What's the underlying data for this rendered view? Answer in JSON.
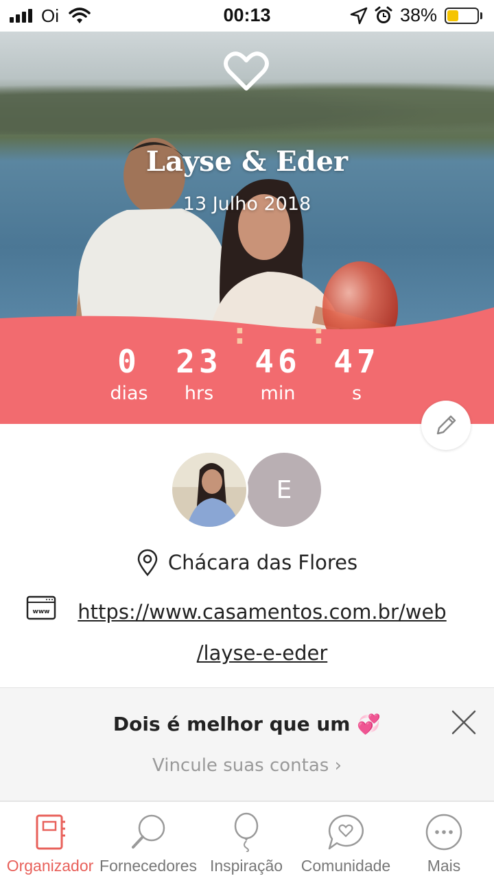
{
  "status_bar": {
    "carrier": "Oi",
    "time": "00:13",
    "battery_percent": "38%",
    "battery_level": 0.38
  },
  "hero": {
    "names": "Layse & Eder",
    "date": "13 Julho 2018",
    "countdown": {
      "days": "0",
      "days_label": "dias",
      "hours": "23",
      "hours_label": "hrs",
      "minutes": "46",
      "minutes_label": "min",
      "seconds": "47",
      "seconds_label": "s"
    }
  },
  "profile": {
    "partner_initial": "E",
    "venue": "Chácara das Flores",
    "website_line1": "https://www.casamentos.com.br/web",
    "website_line2": "/layse-e-eder"
  },
  "promo": {
    "title": "Dois é melhor que um 💞",
    "link": "Vincule suas contas  ›"
  },
  "tabs": [
    {
      "label": "Organizador",
      "icon": "notebook-icon",
      "active": true
    },
    {
      "label": "Fornecedores",
      "icon": "search-icon",
      "active": false
    },
    {
      "label": "Inspiração",
      "icon": "balloon-icon",
      "active": false
    },
    {
      "label": "Comunidade",
      "icon": "chat-heart-icon",
      "active": false
    },
    {
      "label": "Mais",
      "icon": "more-icon",
      "active": false
    }
  ],
  "colors": {
    "accent": "#f26b6f",
    "tab_active": "#e8605a"
  }
}
